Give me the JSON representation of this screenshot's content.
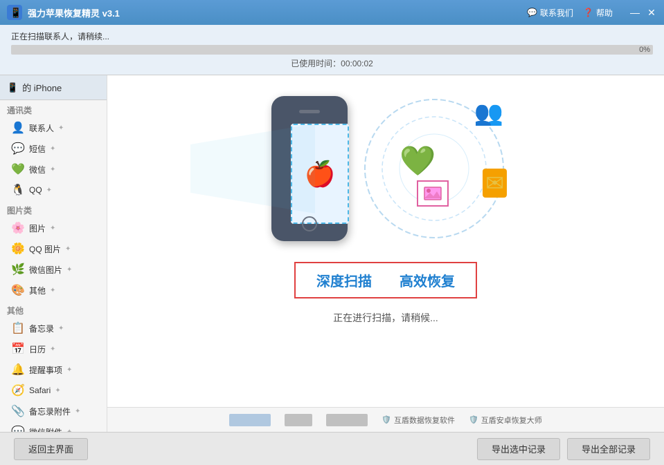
{
  "titleBar": {
    "icon": "💻",
    "title": "强力苹果恢复精灵 v3.1",
    "contactUs": "联系我们",
    "help": "帮助",
    "minimize": "—",
    "close": "✕"
  },
  "progress": {
    "scanningText": "正在扫描联系人，请稍续...",
    "percentage": "0%",
    "timeLabel": "已使用时间：00:00:02"
  },
  "sidebar": {
    "deviceName": "的 iPhone",
    "sections": [
      {
        "title": "通讯类",
        "items": [
          {
            "label": "联系人",
            "icon": "👤"
          },
          {
            "label": "短信",
            "icon": "💬"
          },
          {
            "label": "微信",
            "icon": "💚"
          },
          {
            "label": "QQ",
            "icon": "🐧"
          }
        ]
      },
      {
        "title": "图片类",
        "items": [
          {
            "label": "图片",
            "icon": "🌸"
          },
          {
            "label": "QQ 图片",
            "icon": "🌼"
          },
          {
            "label": "微信图片",
            "icon": "🌿"
          },
          {
            "label": "其他",
            "icon": "🎨"
          }
        ]
      },
      {
        "title": "其他",
        "items": [
          {
            "label": "备忘录",
            "icon": "📋"
          },
          {
            "label": "日历",
            "icon": "📅"
          },
          {
            "label": "提醒事项",
            "icon": "🔔"
          },
          {
            "label": "Safari",
            "icon": "🧭"
          },
          {
            "label": "备忘录附件",
            "icon": "📎"
          },
          {
            "label": "微信附件",
            "icon": "💬"
          }
        ]
      }
    ]
  },
  "content": {
    "deepScanLabel": "深度扫描",
    "efficientRecoverLabel": "高效恢复",
    "scanningText": "正在进行扫描，请稍候...",
    "adItems": [
      {
        "label": "互盾数据恢复软件",
        "icon": "🛡️"
      },
      {
        "label": "互盾安卓恢复大师",
        "icon": "🛡️"
      }
    ]
  },
  "footer": {
    "backBtn": "返回主界面",
    "exportSelectedBtn": "导出选中记录",
    "exportAllBtn": "导出全部记录"
  }
}
